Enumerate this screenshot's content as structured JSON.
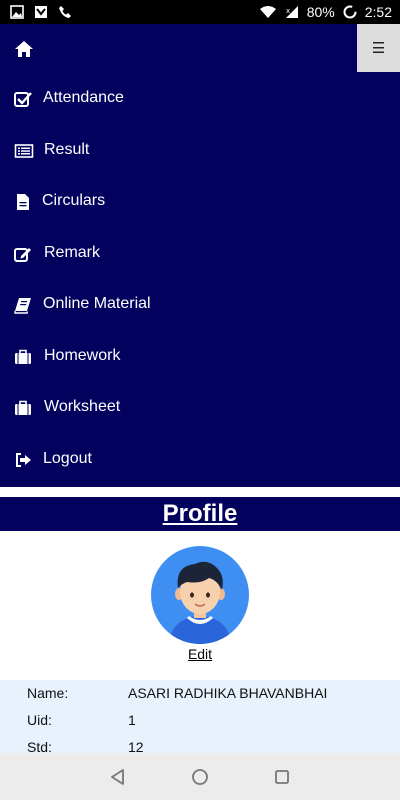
{
  "status_bar": {
    "battery": "80%",
    "time": "2:52",
    "icons": [
      "image-icon",
      "flag-icon",
      "phone-icon",
      "wifi-icon",
      "signal-icon",
      "battery-icon"
    ]
  },
  "nav": {
    "background": "#02015e",
    "home_icon": "home-icon",
    "menu_icon": "hamburger-icon",
    "menu_glyph": "☰",
    "items": [
      {
        "label": "Attendance",
        "icon": "check-square-icon"
      },
      {
        "label": "Result",
        "icon": "list-icon"
      },
      {
        "label": "Circulars",
        "icon": "document-icon"
      },
      {
        "label": "Remark",
        "icon": "edit-icon"
      },
      {
        "label": "Online Material",
        "icon": "book-icon"
      },
      {
        "label": "Homework",
        "icon": "briefcase-icon"
      },
      {
        "label": "Worksheet",
        "icon": "briefcase-icon"
      },
      {
        "label": "Logout",
        "icon": "logout-icon"
      }
    ]
  },
  "profile": {
    "title": "Profile",
    "edit_label": "Edit",
    "avatar_icon": "user-avatar-icon",
    "fields": [
      {
        "key": "Name:",
        "value": "ASARI RADHIKA BHAVANBHAI"
      },
      {
        "key": "Uid:",
        "value": "1"
      },
      {
        "key": "Std:",
        "value": "12"
      }
    ]
  },
  "system_nav": {
    "icons": [
      "back-icon",
      "home-circle-icon",
      "recents-icon"
    ]
  }
}
